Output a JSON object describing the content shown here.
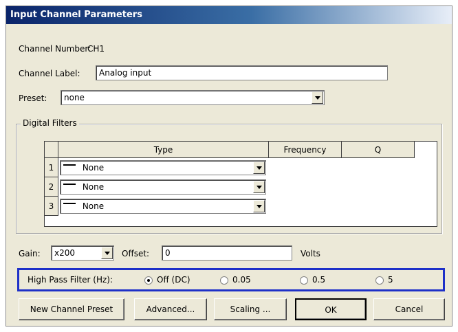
{
  "window": {
    "title": "Input Channel Parameters"
  },
  "channel": {
    "number_label": "Channel Number:",
    "number_value": "CH1",
    "label_label": "Channel Label:",
    "label_value": "Analog input"
  },
  "preset": {
    "label": "Preset:",
    "value": "none"
  },
  "filters": {
    "group_label": "Digital Filters",
    "columns": [
      "Type",
      "Frequency",
      "Q"
    ],
    "rows": [
      {
        "num": "1",
        "type": "None"
      },
      {
        "num": "2",
        "type": "None"
      },
      {
        "num": "3",
        "type": "None"
      }
    ]
  },
  "gain": {
    "label": "Gain:",
    "value": "x200"
  },
  "offset": {
    "label": "Offset:",
    "value": "0",
    "unit": "Volts"
  },
  "highpass": {
    "label": "High Pass Filter (Hz):",
    "options": [
      "Off (DC)",
      "0.05",
      "0.5",
      "5"
    ],
    "selected": "Off (DC)"
  },
  "buttons": {
    "new_preset": "New Channel Preset",
    "advanced": "Advanced...",
    "scaling": "Scaling ...",
    "ok": "OK",
    "cancel": "Cancel"
  }
}
